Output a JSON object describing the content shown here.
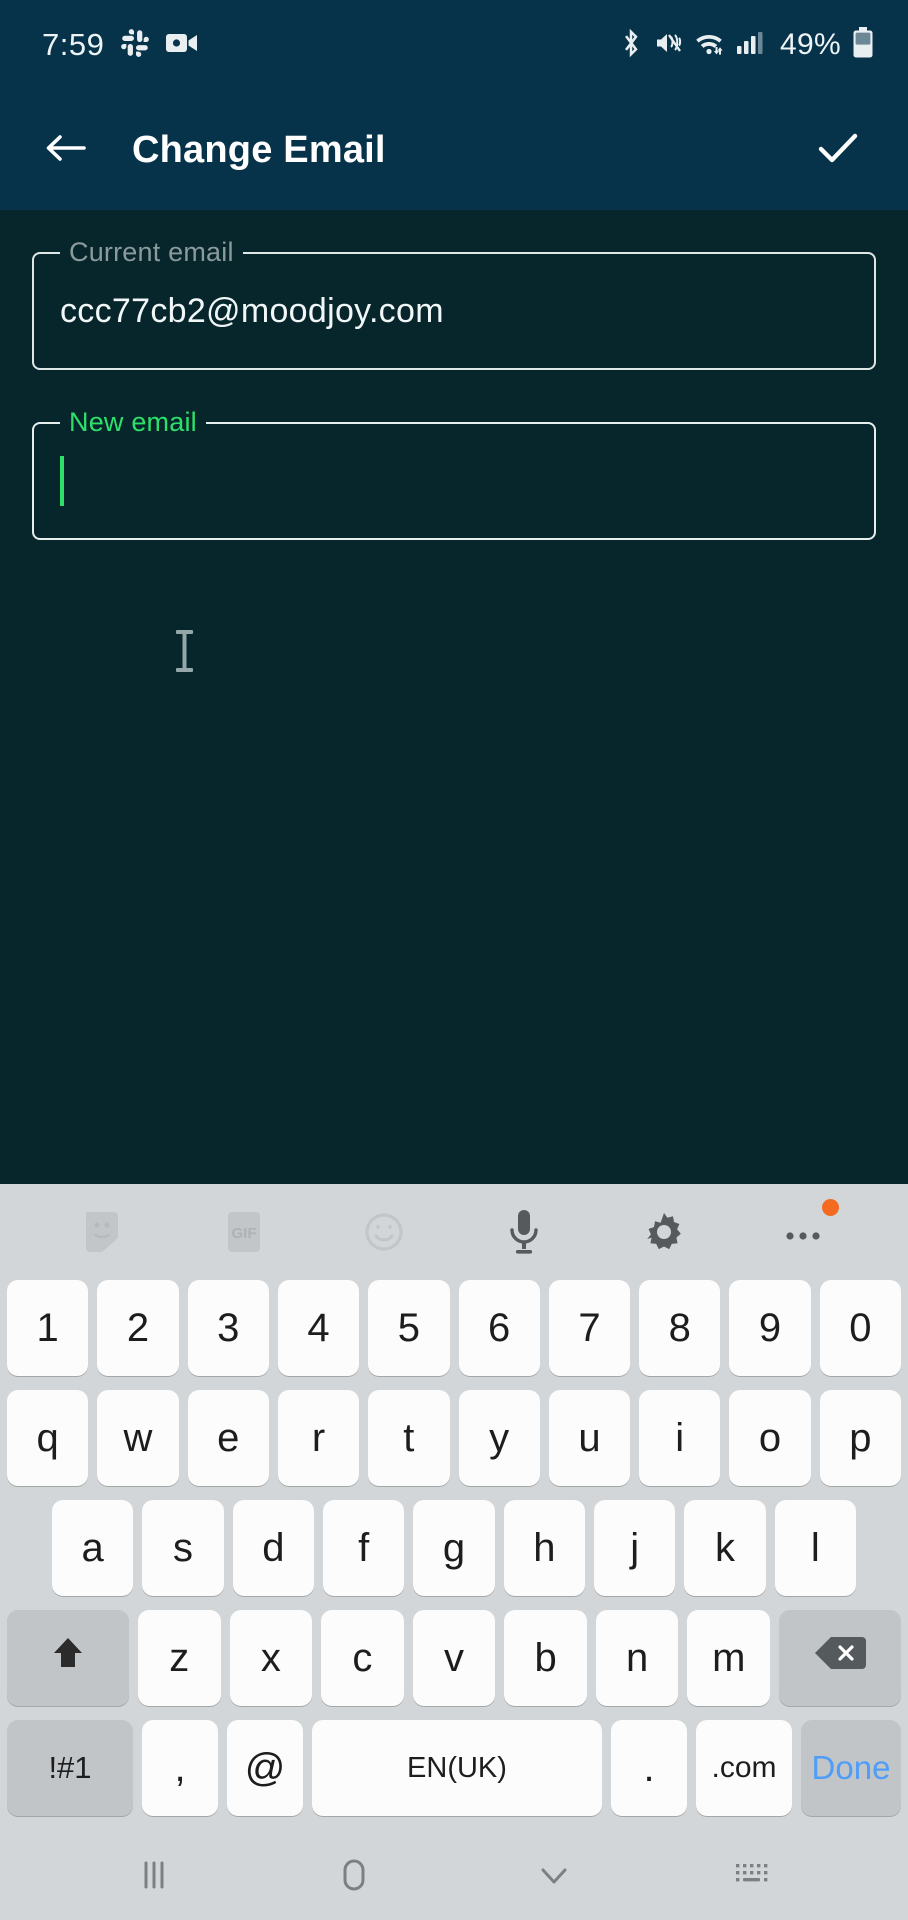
{
  "status_bar": {
    "time": "7:59",
    "battery_percent": "49%",
    "left_icons": [
      "slack-icon",
      "video-camera-icon"
    ],
    "right_icons": [
      "bluetooth-icon",
      "vibrate-mute-icon",
      "wifi-icon",
      "cellular-signal-icon"
    ]
  },
  "app_bar": {
    "back_label": "back-arrow",
    "title": "Change Email",
    "confirm_label": "confirm-check"
  },
  "form": {
    "current_email": {
      "legend": "Current email",
      "value": "ccc77cb2@moodjoy.com",
      "focused": false
    },
    "new_email": {
      "legend": "New email",
      "value": "",
      "placeholder": "",
      "focused": true
    }
  },
  "colors": {
    "app_bar": "#063349",
    "background": "#07262c",
    "accent_green": "#2ee06a",
    "keyboard_bg": "#d3d6d8",
    "key_bg": "#fcfcfc",
    "done_blue": "#4f9df7",
    "badge_orange": "#f26b21"
  },
  "keyboard": {
    "toolbar": [
      {
        "name": "sticker-icon",
        "label": ""
      },
      {
        "name": "gif-icon",
        "label": "GIF"
      },
      {
        "name": "emoji-icon",
        "label": ""
      },
      {
        "name": "microphone-icon",
        "label": ""
      },
      {
        "name": "gear-icon",
        "label": ""
      },
      {
        "name": "more-options-icon",
        "label": ""
      }
    ],
    "row_numbers": [
      "1",
      "2",
      "3",
      "4",
      "5",
      "6",
      "7",
      "8",
      "9",
      "0"
    ],
    "row_q": [
      "q",
      "w",
      "e",
      "r",
      "t",
      "y",
      "u",
      "i",
      "o",
      "p"
    ],
    "row_a": [
      "a",
      "s",
      "d",
      "f",
      "g",
      "h",
      "j",
      "k",
      "l"
    ],
    "row_z": [
      "z",
      "x",
      "c",
      "v",
      "b",
      "n",
      "m"
    ],
    "shift_label": "shift-icon",
    "backspace_label": "backspace-icon",
    "bottom": {
      "symbols": "!#1",
      "comma": ",",
      "at": "@",
      "space": "EN(UK)",
      "period": ".",
      "dotcom": ".com",
      "done": "Done"
    }
  },
  "nav_bar": {
    "recents": "recents-icon",
    "home": "home-icon",
    "back": "dismiss-keyboard-icon",
    "keyboard_switch": "keyboard-switch-icon"
  }
}
